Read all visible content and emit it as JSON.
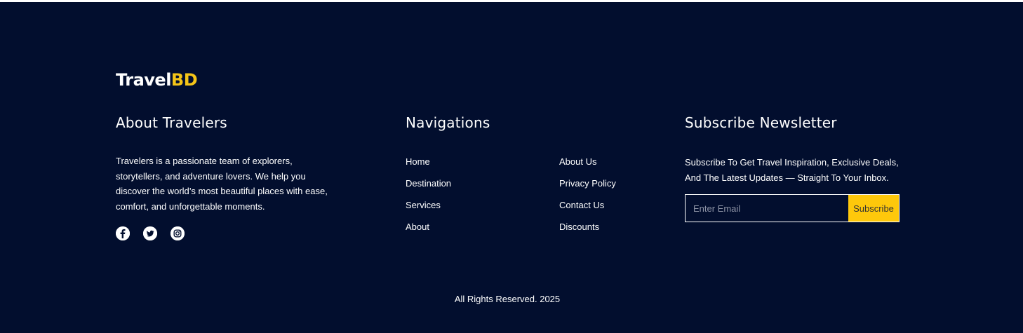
{
  "brand": {
    "logo_main": "Travel",
    "logo_accent": "BD",
    "accent_color": "#f5c518",
    "background_color": "#020e2e"
  },
  "about": {
    "title": "About Travelers",
    "text": "Travelers is a passionate team of explorers, storytellers, and adventure lovers. We help you discover the world’s most beautiful places with ease, comfort, and unforgettable moments.",
    "socials": [
      {
        "icon": "facebook-icon"
      },
      {
        "icon": "twitter-icon"
      },
      {
        "icon": "instagram-icon"
      }
    ]
  },
  "navigations": {
    "title": "Navigations",
    "col1": [
      "Home",
      "Destination",
      "Services",
      "About"
    ],
    "col2": [
      "About Us",
      "Privacy Policy",
      "Contact Us",
      "Discounts"
    ]
  },
  "newsletter": {
    "title": "Subscribe Newsletter",
    "text": "Subscribe To Get Travel Inspiration, Exclusive Deals, And The Latest Updates — Straight To Your Inbox.",
    "email_placeholder": "Enter Email",
    "email_value": "",
    "button_label": "Subscribe",
    "button_color": "#fec80b"
  },
  "copyright": "All Rights Reserved. 2025"
}
